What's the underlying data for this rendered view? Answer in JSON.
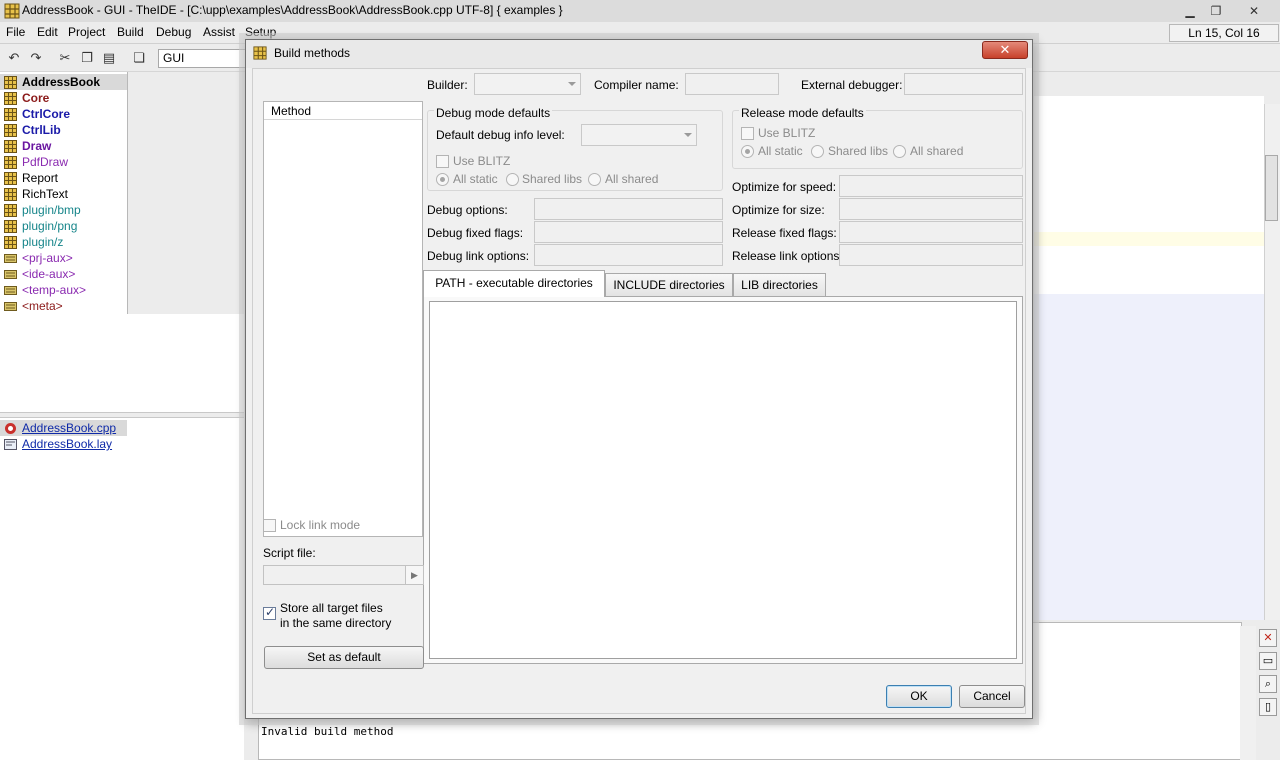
{
  "window": {
    "title": "AddressBook - GUI - TheIDE - [C:\\upp\\examples\\AddressBook\\AddressBook.cpp UTF-8] { examples }",
    "controls": {
      "minimize": "▁",
      "maximize": "❐",
      "close": "✕"
    }
  },
  "menu": [
    "File",
    "Edit",
    "Project",
    "Build",
    "Debug",
    "Assist",
    "Setup"
  ],
  "status_position": "Ln 15, Col 16",
  "toolbar": {
    "config": "GUI",
    "icons": [
      "undo-icon",
      "redo-icon",
      "cut-icon",
      "copy-icon",
      "paste-icon",
      "copy-clip-icon"
    ]
  },
  "packages": [
    {
      "label": "AddressBook",
      "color": "#000000",
      "bold": true,
      "selected": true
    },
    {
      "label": "Core",
      "color": "#8b1a1a",
      "bold": true
    },
    {
      "label": "CtrlCore",
      "color": "#1a1aa8",
      "bold": true
    },
    {
      "label": "CtrlLib",
      "color": "#1a1aa8",
      "bold": true
    },
    {
      "label": "Draw",
      "color": "#6a16a0",
      "bold": true
    },
    {
      "label": "PdfDraw",
      "color": "#8a2ab0",
      "bold": false
    },
    {
      "label": "Report",
      "color": "#000000",
      "bold": false
    },
    {
      "label": "RichText",
      "color": "#000000",
      "bold": false
    },
    {
      "label": "plugin/bmp",
      "color": "#16858a",
      "bold": false
    },
    {
      "label": "plugin/png",
      "color": "#16858a",
      "bold": false
    },
    {
      "label": "plugin/z",
      "color": "#16858a",
      "bold": false
    },
    {
      "label": "<prj-aux>",
      "color": "#8a2ab0",
      "bold": false
    },
    {
      "label": "<ide-aux>",
      "color": "#8a2ab0",
      "bold": false
    },
    {
      "label": "<temp-aux>",
      "color": "#8a2ab0",
      "bold": false
    },
    {
      "label": "<meta>",
      "color": "#8b1a1a",
      "bold": false
    }
  ],
  "files": [
    {
      "label": "AddressBook.cpp",
      "selected": true
    },
    {
      "label": "AddressBook.lay",
      "selected": false
    }
  ],
  "console": {
    "message": "Invalid build method"
  },
  "dialog": {
    "title": "Build methods",
    "close_glyph": "✕",
    "method_header": "Method",
    "builder_label": "Builder:",
    "compiler_label": "Compiler name:",
    "debugger_label": "External debugger:",
    "debug_group": {
      "title": "Debug mode defaults",
      "info_level_label": "Default debug info level:",
      "blitz_label": "Use BLITZ",
      "all_static": "All static",
      "shared_libs": "Shared libs",
      "all_shared": "All shared"
    },
    "release_group": {
      "title": "Release mode defaults",
      "blitz_label": "Use BLITZ",
      "all_static": "All static",
      "shared_libs": "Shared libs",
      "all_shared": "All shared"
    },
    "opt_speed_label": "Optimize for speed:",
    "opt_size_label": "Optimize for size:",
    "debug_options_label": "Debug options:",
    "debug_fixed_label": "Debug fixed flags:",
    "debug_link_label": "Debug link options:",
    "release_fixed_label": "Release fixed flags:",
    "release_link_label": "Release link options:",
    "lock_link_label": "Lock link mode",
    "script_label": "Script file:",
    "store_label_line1": "Store all target files",
    "store_label_line2": "in the same directory",
    "set_default_label": "Set as default",
    "tabs": [
      "PATH - executable directories",
      "INCLUDE directories",
      "LIB directories"
    ],
    "ok_label": "OK",
    "cancel_label": "Cancel"
  }
}
